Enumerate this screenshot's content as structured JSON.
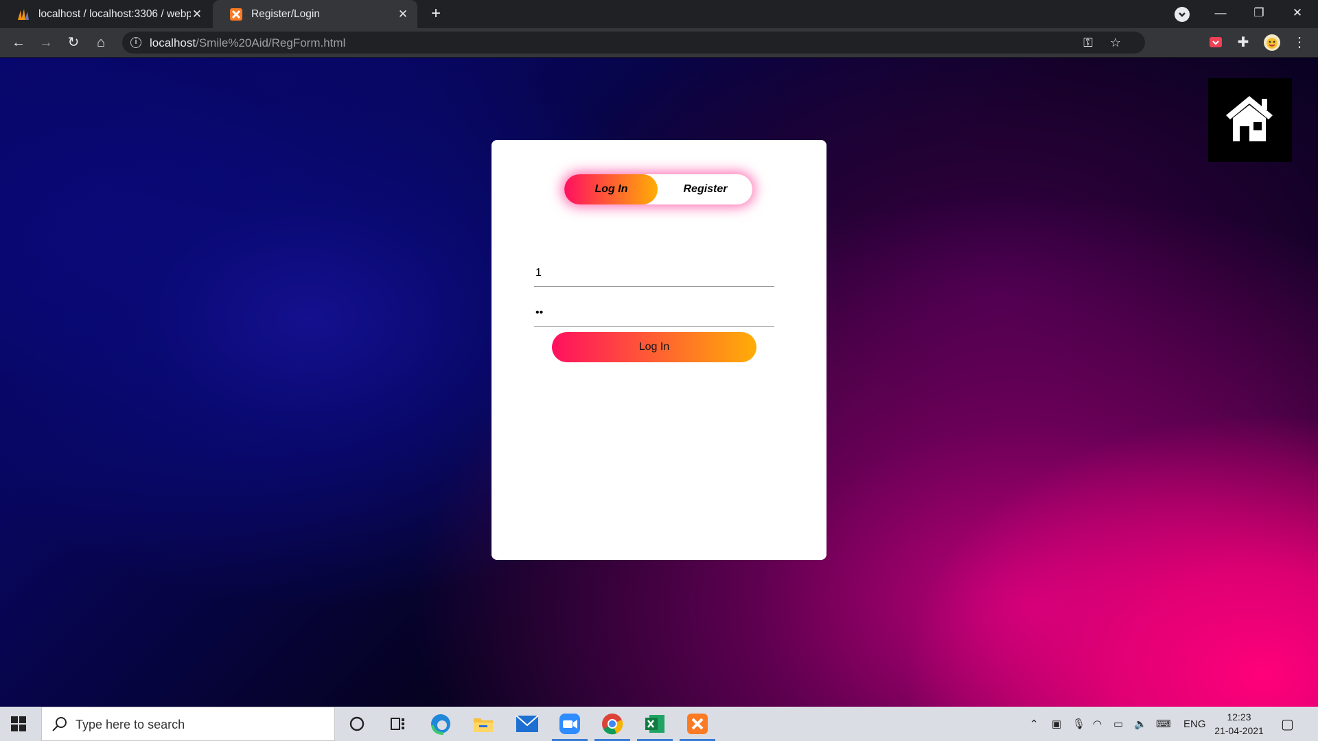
{
  "browser": {
    "tabs": [
      {
        "title": "localhost / localhost:3306 / webp",
        "active": false
      },
      {
        "title": "Register/Login",
        "active": true
      }
    ],
    "url_host": "localhost",
    "url_path": "/Smile%20Aid/RegForm.html"
  },
  "page": {
    "toggle": {
      "login_label": "Log In",
      "register_label": "Register",
      "selected": "Log In"
    },
    "username_value": "1",
    "password_value": "••",
    "submit_label": "Log In"
  },
  "taskbar": {
    "search_placeholder": "Type here to search",
    "language": "ENG",
    "time": "12:23",
    "date": "21-04-2021"
  },
  "colors": {
    "gradient_start": "#ff105f",
    "gradient_end": "#ffad06",
    "card": "#ffffff"
  }
}
